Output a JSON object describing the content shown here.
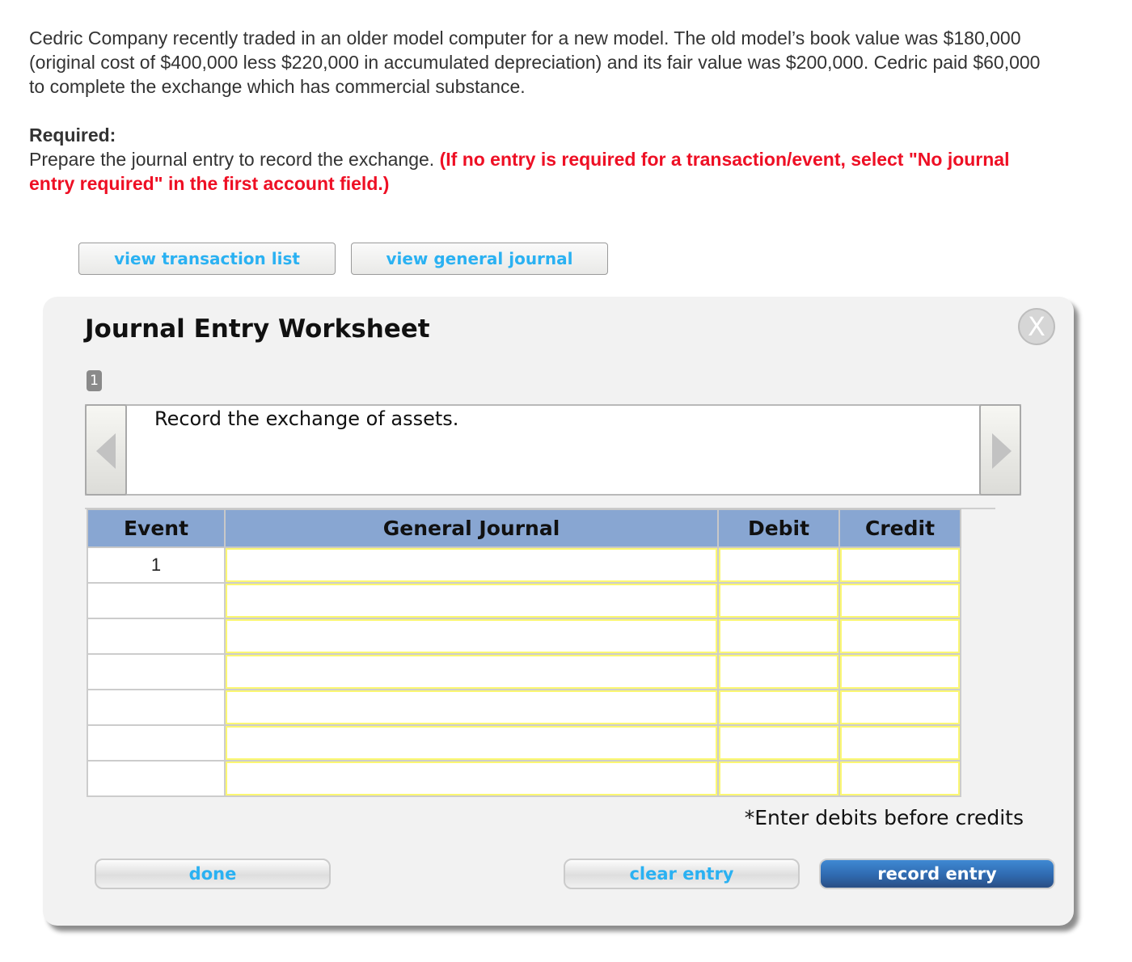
{
  "problem": {
    "paragraph": "Cedric Company recently traded in an older model computer for a new model. The old model’s book value was $180,000 (original cost of $400,000 less $220,000 in accumulated depreciation) and its fair value was $200,000. Cedric paid $60,000 to complete the exchange which has commercial substance.",
    "required_heading": "Required:",
    "instruction": "Prepare the journal entry to record the exchange. ",
    "instruction_note": "(If no entry is required for a transaction/event, select \"No journal entry required\" in the first account field.)"
  },
  "toolbar": {
    "view_transaction_list": "view transaction list",
    "view_general_journal": "view general journal"
  },
  "worksheet": {
    "title": "Journal Entry Worksheet",
    "close_icon": "close-icon",
    "close_glyph": "X",
    "page_badge": "1",
    "description": "Record the exchange of assets.",
    "prev_icon": "triangle-left-icon",
    "next_icon": "triangle-right-icon",
    "columns": [
      "Event",
      "General Journal",
      "Debit",
      "Credit"
    ],
    "rows": [
      {
        "event": "1",
        "account": "",
        "debit": "",
        "credit": ""
      },
      {
        "event": "",
        "account": "",
        "debit": "",
        "credit": ""
      },
      {
        "event": "",
        "account": "",
        "debit": "",
        "credit": ""
      },
      {
        "event": "",
        "account": "",
        "debit": "",
        "credit": ""
      },
      {
        "event": "",
        "account": "",
        "debit": "",
        "credit": ""
      },
      {
        "event": "",
        "account": "",
        "debit": "",
        "credit": ""
      },
      {
        "event": "",
        "account": "",
        "debit": "",
        "credit": ""
      }
    ],
    "note": "*Enter debits before credits",
    "buttons": {
      "done": "done",
      "clear_entry": "clear entry",
      "record_entry": "record entry"
    }
  },
  "colors": {
    "link_blue": "#2ab1f2",
    "warning_red": "#ee0f24",
    "header_blue": "#88a6d2",
    "input_yellow": "#fbf772",
    "primary_button": "#2f6ab0"
  }
}
